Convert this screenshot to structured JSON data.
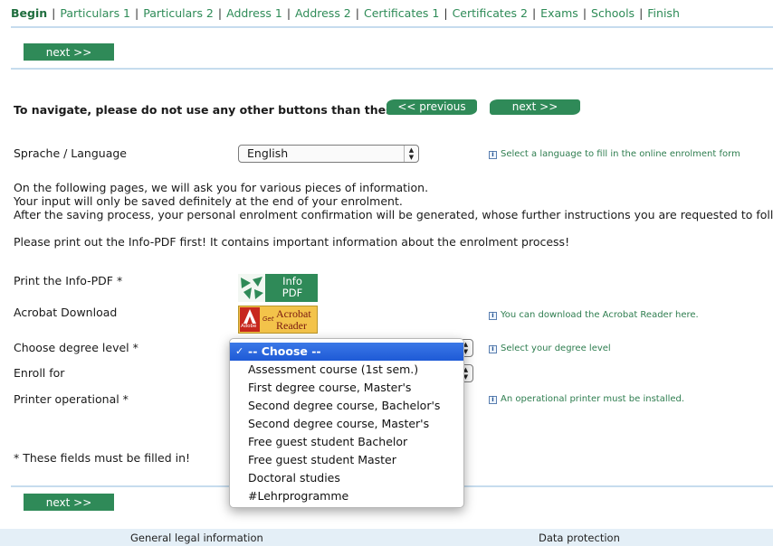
{
  "nav": {
    "tabs": [
      "Begin",
      "Particulars 1",
      "Particulars 2",
      "Address 1",
      "Address 2",
      "Certificates 1",
      "Certificates 2",
      "Exams",
      "Schools",
      "Finish"
    ],
    "separator": "|"
  },
  "buttons": {
    "next": "next >>",
    "previous": "<< previous"
  },
  "navigation_note": "To navigate, please do not use any other buttons than these!",
  "language": {
    "label": "Sprache / Language",
    "value": "English",
    "hint": "Select a language to fill in the online enrolment form"
  },
  "intro": {
    "line1": "On the following pages, we will ask you for various pieces of information.",
    "line2": "Your input will only be saved definitely at the end of your enrolment.",
    "line3": "After the saving process, your personal enrolment confirmation will be generated, whose further instructions you are requested to follow.",
    "line4": "Please print out the Info-PDF first! It contains important information about the enrolment process!"
  },
  "info_pdf": {
    "label": "Print the Info-PDF *",
    "logo_line1": "Info",
    "logo_line2": "PDF"
  },
  "acrobat": {
    "label": "Acrobat Download",
    "hint": "You can download the Acrobat Reader here.",
    "logo_adobe": "Adobe",
    "logo_get": "Get",
    "logo_acrobat": "Acrobat",
    "logo_reader": "Reader"
  },
  "degree": {
    "label": "Choose degree level *",
    "hint": "Select your degree level",
    "options": [
      "-- Choose --",
      "Assessment course (1st sem.)",
      "First degree course, Master's",
      "Second degree course, Bachelor's",
      "Second degree course, Master's",
      "Free guest student Bachelor",
      "Free guest student Master",
      "Doctoral studies",
      "#Lehrprogramme"
    ],
    "check_mark": "✓"
  },
  "enroll": {
    "label": "Enroll for"
  },
  "printer": {
    "label": "Printer operational *",
    "hint": "An operational printer must be installed."
  },
  "required_note": "* These fields must be filled in!",
  "footer": {
    "legal": "General legal information",
    "privacy": "Data protection"
  },
  "colors": {
    "accent": "#2f8a58",
    "link": "#2e8b57",
    "rule": "#c6dcee",
    "selection": "#2a64dc"
  }
}
